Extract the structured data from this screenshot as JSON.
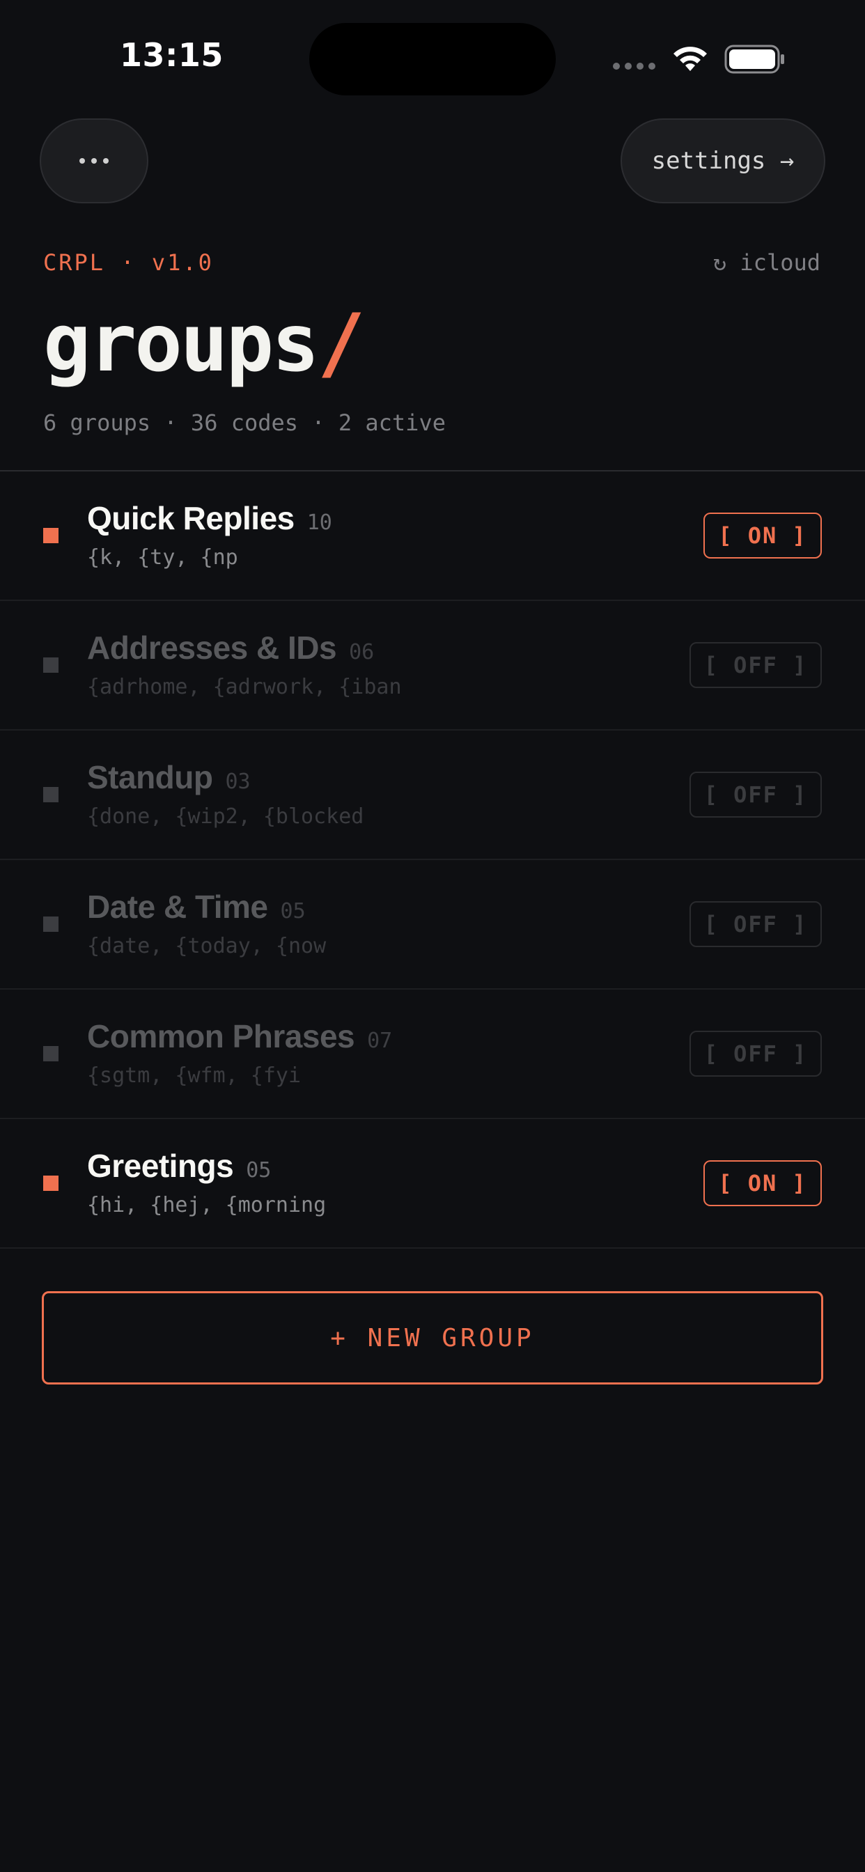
{
  "status_bar": {
    "time": "13:15"
  },
  "header": {
    "more_label": "•••",
    "settings_label": "settings →",
    "brand": "CRPL · v1.0",
    "sync_label": "↻ icloud",
    "title": "groups",
    "title_accent": "/",
    "summary": "6 groups · 36 codes · 2 active"
  },
  "colors": {
    "accent": "#f0714f",
    "background": "#0e0f12",
    "active_text": "#f7f7f4",
    "inactive_text": "#58595c"
  },
  "groups": [
    {
      "name": "Quick Replies",
      "count": "10",
      "codes": "{k, {ty, {np",
      "toggle": "[ ON ]",
      "active": true
    },
    {
      "name": "Addresses & IDs",
      "count": "06",
      "codes": "{adrhome, {adrwork, {iban",
      "toggle": "[ OFF ]",
      "active": false
    },
    {
      "name": "Standup",
      "count": "03",
      "codes": "{done, {wip2, {blocked",
      "toggle": "[ OFF ]",
      "active": false
    },
    {
      "name": "Date & Time",
      "count": "05",
      "codes": "{date, {today, {now",
      "toggle": "[ OFF ]",
      "active": false
    },
    {
      "name": "Common Phrases",
      "count": "07",
      "codes": "{sgtm, {wfm, {fyi",
      "toggle": "[ OFF ]",
      "active": false
    },
    {
      "name": "Greetings",
      "count": "05",
      "codes": "{hi, {hej, {morning",
      "toggle": "[ ON ]",
      "active": true
    }
  ],
  "new_group_label": "+ NEW GROUP"
}
